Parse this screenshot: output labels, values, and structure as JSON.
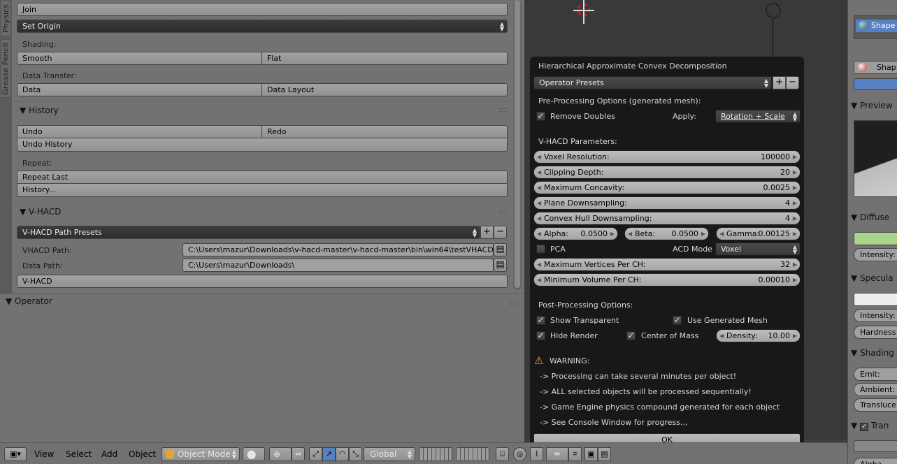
{
  "vtabs": [
    "Physics",
    "Grease Pencil"
  ],
  "shelf": {
    "join": "Join",
    "set_origin": "Set Origin",
    "shading_label": "Shading:",
    "smooth": "Smooth",
    "flat": "Flat",
    "data_transfer_label": "Data Transfer:",
    "data": "Data",
    "data_layout": "Data Layout",
    "history_title": "History",
    "undo": "Undo",
    "redo": "Redo",
    "undo_history": "Undo History",
    "repeat_label": "Repeat:",
    "repeat_last": "Repeat Last",
    "history_more": "History...",
    "vhacd_title": "V-HACD",
    "path_presets": "V-HACD Path Presets",
    "vhacd_path_label": "VHACD Path:",
    "vhacd_path_value": "C:\\Users\\mazur\\Downloads\\v-hacd-master\\v-hacd-master\\bin\\win64\\testVHACD.exe",
    "data_path_label": "Data Path:",
    "data_path_value": "C:\\Users\\mazur\\Downloads\\",
    "vhacd_button": "V-HACD"
  },
  "operator_panel": {
    "title": "Operator"
  },
  "popup": {
    "title": "Hierarchical Approximate Convex Decomposition",
    "operator_presets": "Operator Presets",
    "pre_label": "Pre-Processing Options (generated mesh):",
    "remove_doubles": "Remove Doubles",
    "apply_label": "Apply:",
    "apply_value": "Rotation + Scale",
    "params_label": "V-HACD Parameters:",
    "params": [
      {
        "name": "Voxel Resolution:",
        "value": "100000"
      },
      {
        "name": "Clipping Depth:",
        "value": "20"
      },
      {
        "name": "Maximum Concavity:",
        "value": "0.0025"
      },
      {
        "name": "Plane Downsampling:",
        "value": "4"
      },
      {
        "name": "Convex Hull Downsampling:",
        "value": "4"
      }
    ],
    "alpha": {
      "name": "Alpha:",
      "value": "0.0500"
    },
    "beta": {
      "name": "Beta:",
      "value": "0.0500"
    },
    "gamma": {
      "name": "Gamma:",
      "value": "0.00125"
    },
    "pca": "PCA",
    "acd_mode_label": "ACD Mode",
    "acd_mode_value": "Voxel",
    "max_vertices": {
      "name": "Maximum Vertices Per CH:",
      "value": "32"
    },
    "min_volume": {
      "name": "Minimum Volume Per CH:",
      "value": "0.00010"
    },
    "post_label": "Post-Processing Options:",
    "show_transparent": "Show Transparent",
    "use_generated_mesh": "Use Generated Mesh",
    "hide_render": "Hide Render",
    "center_of_mass": "Center of Mass",
    "density": {
      "name": "Density:",
      "value": "10.00"
    },
    "warning_title": "WARNING:",
    "warnings": [
      "-> Processing can take several minutes per object!",
      "-> ALL selected objects will be processed sequentially!",
      "-> Game Engine physics compound generated for each object",
      "-> See Console Window for progress..,"
    ],
    "ok": "OK"
  },
  "properties": {
    "shape": "Shape",
    "shape2": "Shap",
    "preview": "Preview",
    "diffuse": "Diffuse",
    "intensity": "Intensity:",
    "specular": "Specula",
    "intensity2": "Intensity:",
    "hardness": "Hardness",
    "shading": "Shading",
    "emit": "Emit:",
    "ambient": "Ambient:",
    "translucency": "Transluce",
    "transparency": "Tran",
    "alpha": "Alpha"
  },
  "bottombar": {
    "view": "View",
    "select": "Select",
    "add": "Add",
    "object": "Object",
    "mode": "Object Mode",
    "orientation": "Global"
  },
  "colors": {
    "accent_blue": "#5680c2",
    "diffuse_green": "#a9d48a",
    "warning_orange": "#e8a23a"
  }
}
